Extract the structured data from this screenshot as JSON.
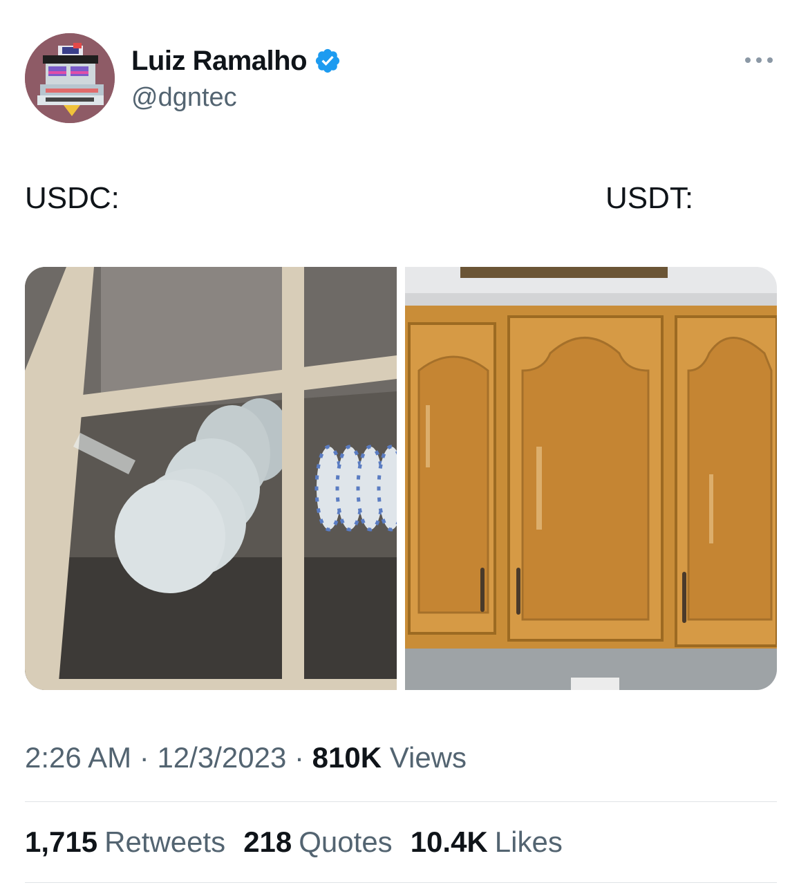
{
  "author": {
    "display_name": "Luiz Ramalho",
    "handle": "@dgntec",
    "avatar_icon": "pixel-art-avatar-icon",
    "verified_icon": "verified-badge-icon"
  },
  "more_icon": "more-options-icon",
  "post": {
    "caption_left": "USDC:",
    "caption_right": "USDT:",
    "media": [
      {
        "subject": "glass-cabinet-with-plates-image"
      },
      {
        "subject": "wooden-kitchen-cabinets-image"
      }
    ]
  },
  "meta": {
    "time": "2:26 AM",
    "separator": "·",
    "date": "12/3/2023",
    "views_count": "810K",
    "views_label": "Views"
  },
  "stats": {
    "retweets_count": "1,715",
    "retweets_label": "Retweets",
    "quotes_count": "218",
    "quotes_label": "Quotes",
    "likes_count": "10.4K",
    "likes_label": "Likes"
  },
  "colors": {
    "text_primary": "#0f1419",
    "text_secondary": "#536471",
    "verified_blue": "#1d9bf0",
    "divider": "#dfe3e6"
  }
}
